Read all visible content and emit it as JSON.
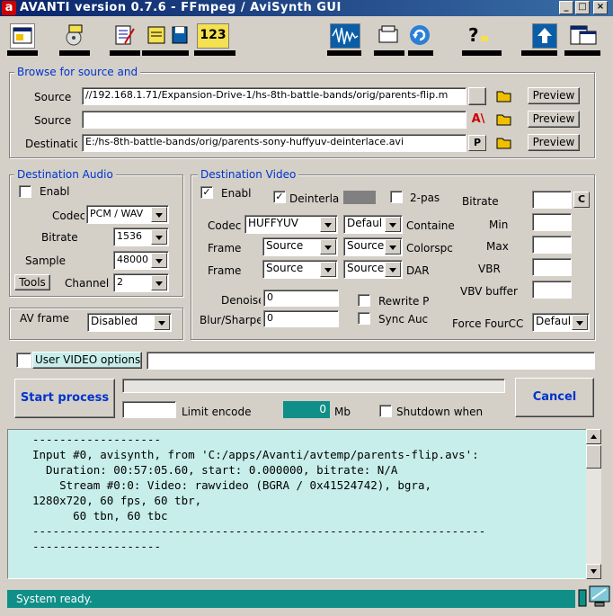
{
  "window": {
    "title": "AVANTI  version 0.7.6  - FFmpeg / AviSynth GUI",
    "logo": "a"
  },
  "toolbar": {
    "icons": [
      "settings-icon",
      "media-disc-icon",
      "edit-list-icon",
      "notes-icon",
      "save-icon",
      "counter-icon",
      "waveform-icon",
      "folder-open-icon",
      "refresh-icon",
      "help-icon",
      "upload-icon",
      "window-list-icon"
    ],
    "counter_text": "123"
  },
  "browse": {
    "title": "Browse for source and",
    "source1_label": "Source",
    "source1_value": "//192.168.1.71/Expansion-Drive-1/hs-8th-battle-bands/orig/parents-flip.m",
    "source2_label": "Source",
    "source2_value": "",
    "dest_label": "Destination",
    "dest_value": "E:/hs-8th-battle-bands/orig/parents-sony-huffyuv-deinterlace.avi",
    "preview_label": "Preview",
    "p_label": "P",
    "a_label": "A\\"
  },
  "audio": {
    "title": "Destination Audio",
    "enable_label": "Enabl",
    "codec_label": "Codec",
    "codec_value": "PCM / WAV",
    "bitrate_label": "Bitrate",
    "bitrate_value": "1536",
    "sample_label": "Sample",
    "sample_value": "48000",
    "tools_label": "Tools",
    "channels_label": "Channel",
    "channels_value": "2"
  },
  "avframe": {
    "label": "AV frame",
    "value": "Disabled"
  },
  "video": {
    "title": "Destination Video",
    "enable_label": "Enabl",
    "enable_checked": "✓",
    "deinterlace_label": "Deinterlac",
    "deinterlace_checked": "✓",
    "twopass_label": "2-pas",
    "bitrate_label": "Bitrate",
    "c_label": "C",
    "codec_label": "Codec",
    "codec_value": "HUFFYUV",
    "codec2_value": "Defaul",
    "container_label": "Containe",
    "min_label": "Min",
    "frame1_label": "Frame",
    "frame1_value": "Source",
    "frame1b_value": "Source",
    "colorspace_label": "Colorspc",
    "max_label": "Max",
    "frame2_label": "Frame",
    "frame2_value": "Source",
    "frame2b_value": "Source",
    "dar_label": "DAR",
    "vbr_label": "VBR",
    "vbvbuffer_label": "VBV buffer",
    "denoise_label": "Denoise",
    "denoise_value": "0",
    "rewrite_label": "Rewrite P",
    "blur_label": "Blur/Sharpe",
    "blur_value": "0",
    "syncaudio_label": "Sync Auc",
    "fourcc_label": "Force FourCC",
    "fourcc_value": "Defaul"
  },
  "user_options": {
    "label": "User VIDEO options >",
    "value": ""
  },
  "process": {
    "start_label": "Start process",
    "cancel_label": "Cancel",
    "limit_label": "Limit encode",
    "limit_value": "",
    "mb_value": "0",
    "mb_label": "Mb",
    "shutdown_label": "Shutdown when"
  },
  "log": {
    "lines": [
      "-------------------",
      "Input #0, avisynth, from 'C:/apps/Avanti/avtemp/parents-flip.avs':",
      "  Duration: 00:57:05.60, start: 0.000000, bitrate: N/A",
      "    Stream #0:0: Video: rawvideo (BGRA / 0x41524742), bgra,",
      "1280x720, 60 fps, 60 tbr,",
      "      60 tbn, 60 tbc",
      "-------------------------------------------------------------------",
      "-------------------"
    ]
  },
  "status": {
    "text": "System ready."
  },
  "colors": {
    "title_bar": "#0a246a",
    "log_bg": "#c7eeea",
    "status_bg": "#0f8f88",
    "group_title": "#0033cc",
    "mb_bg": "#0f8f88"
  }
}
